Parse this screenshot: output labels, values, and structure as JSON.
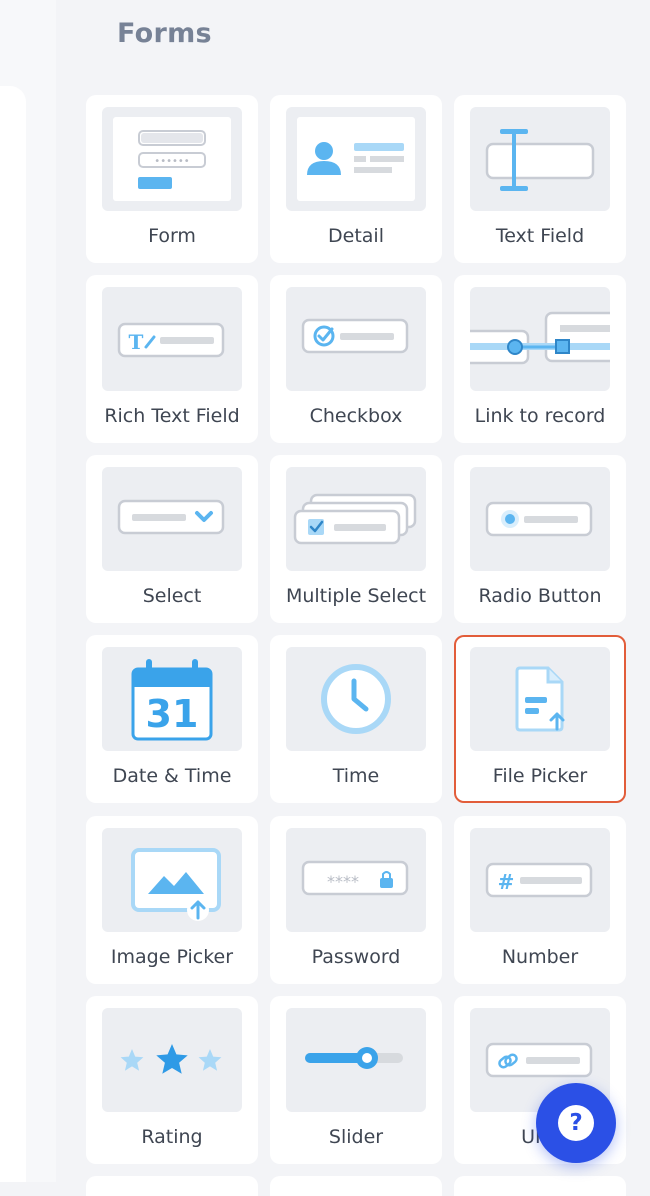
{
  "section": {
    "title": "Forms"
  },
  "components": [
    {
      "id": "form",
      "label": "Form",
      "icon": "form-icon"
    },
    {
      "id": "detail",
      "label": "Detail",
      "icon": "detail-icon"
    },
    {
      "id": "text-field",
      "label": "Text Field",
      "icon": "text-field-icon"
    },
    {
      "id": "rich-text-field",
      "label": "Rich Text Field",
      "icon": "rich-text-icon"
    },
    {
      "id": "checkbox",
      "label": "Checkbox",
      "icon": "checkbox-icon"
    },
    {
      "id": "link-to-record",
      "label": "Link to record",
      "icon": "link-record-icon"
    },
    {
      "id": "select",
      "label": "Select",
      "icon": "select-icon"
    },
    {
      "id": "multiple-select",
      "label": "Multiple Select",
      "icon": "multiple-select-icon"
    },
    {
      "id": "radio-button",
      "label": "Radio Button",
      "icon": "radio-icon"
    },
    {
      "id": "date-time",
      "label": "Date & Time",
      "icon": "calendar-icon",
      "calendar_day": "31"
    },
    {
      "id": "time",
      "label": "Time",
      "icon": "clock-icon"
    },
    {
      "id": "file-picker",
      "label": "File Picker",
      "icon": "file-upload-icon",
      "selected": true
    },
    {
      "id": "image-picker",
      "label": "Image Picker",
      "icon": "image-upload-icon"
    },
    {
      "id": "password",
      "label": "Password",
      "icon": "password-icon",
      "mask": "****"
    },
    {
      "id": "number",
      "label": "Number",
      "icon": "number-icon",
      "symbol": "#"
    },
    {
      "id": "rating",
      "label": "Rating",
      "icon": "stars-icon"
    },
    {
      "id": "slider",
      "label": "Slider",
      "icon": "slider-icon"
    },
    {
      "id": "url",
      "label": "URL",
      "icon": "link-icon"
    }
  ],
  "help": {
    "label": "?",
    "icon": "help-icon"
  },
  "colors": {
    "accent": "#5bb5f0",
    "accent_light": "#a9d8f7",
    "selection_border": "#e25d3a",
    "help_button": "#2b50e6"
  }
}
